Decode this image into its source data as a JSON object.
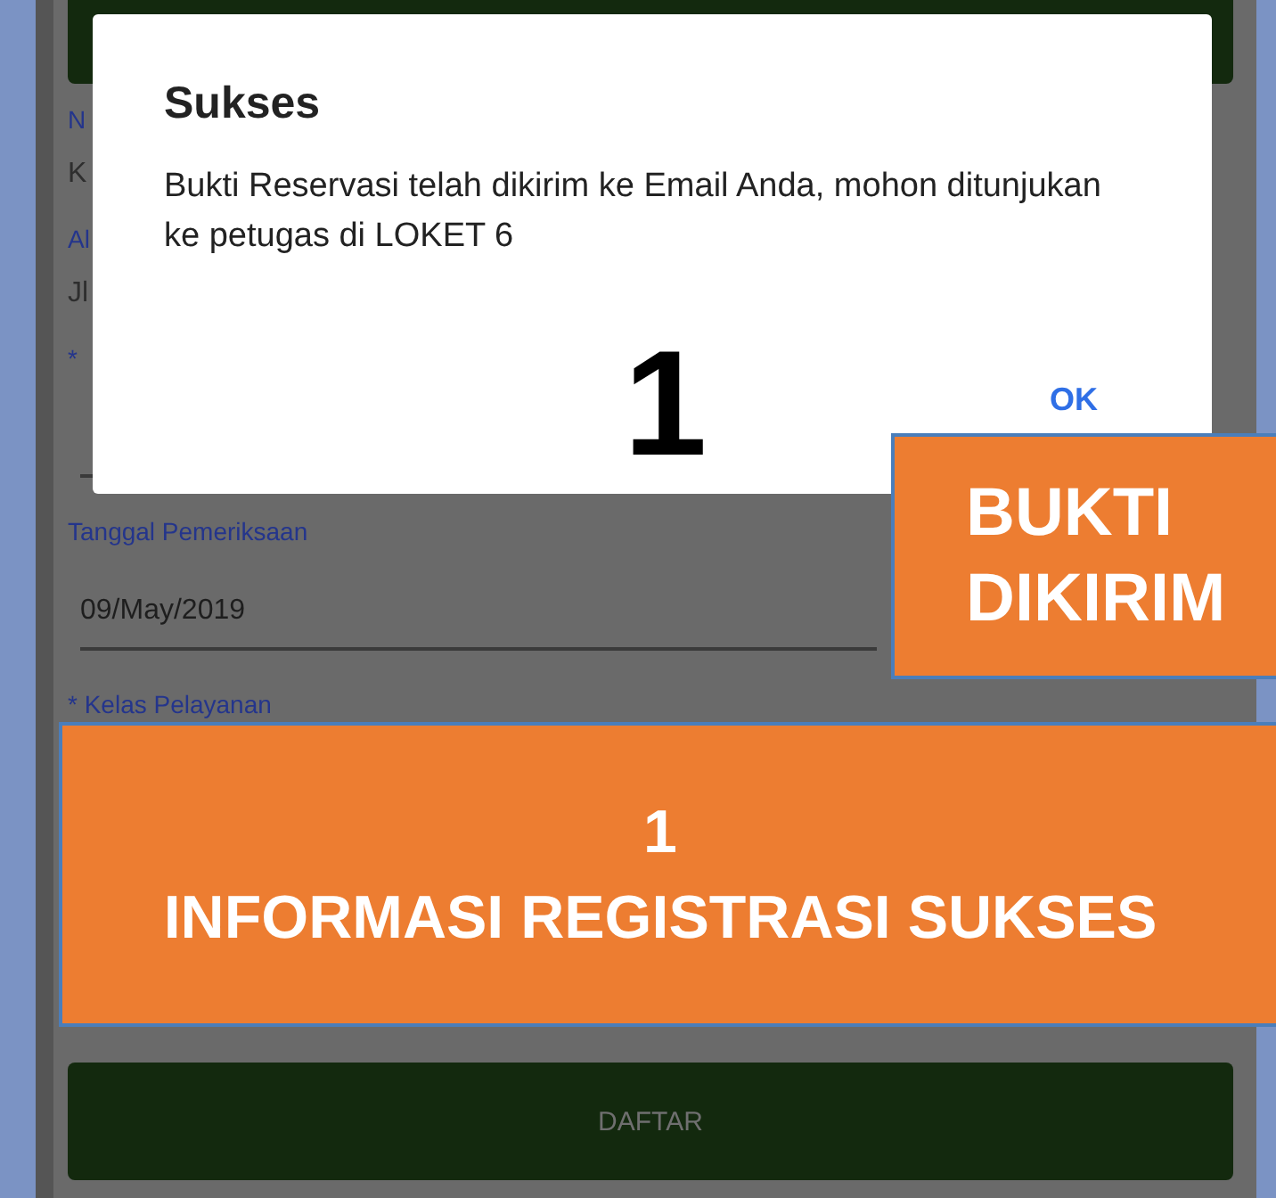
{
  "form": {
    "items": [
      {
        "kind": "label",
        "text": "N"
      },
      {
        "kind": "value",
        "text": "K"
      },
      {
        "kind": "label",
        "text": "Al"
      },
      {
        "kind": "value",
        "text": "Jl"
      },
      {
        "kind": "label",
        "text": "*"
      },
      {
        "kind": "field"
      },
      {
        "kind": "label",
        "text": "Tanggal Pemeriksaan"
      },
      {
        "kind": "field",
        "text": "09/May/2019"
      },
      {
        "kind": "label",
        "text": "* Kelas Pelayanan"
      }
    ],
    "submit_button": "DAFTAR"
  },
  "dialog": {
    "title": "Sukses",
    "message": "Bukti Reservasi telah dikirim ke Email Anda, mohon ditunjukan ke petugas di LOKET 6",
    "ok_button": "OK"
  },
  "annotations": {
    "step_number": "1",
    "callouts": [
      {
        "kind": "side",
        "lines": [
          "BUKTI",
          "DIKIRIM"
        ]
      },
      {
        "kind": "banner",
        "lines": [
          "1",
          "INFORMASI REGISTRASI SUKSES"
        ]
      }
    ]
  }
}
